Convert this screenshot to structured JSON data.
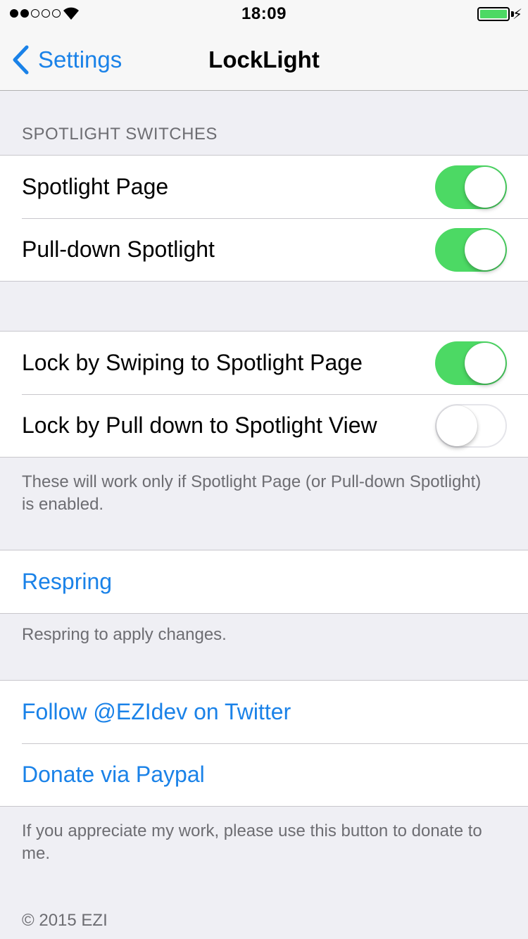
{
  "status_bar": {
    "time": "18:09",
    "signal_bars_filled": 2,
    "signal_bars_total": 5,
    "battery_level": 1.0,
    "charging": true,
    "icons": [
      "wifi-icon",
      "battery-icon",
      "charging-bolt-icon"
    ]
  },
  "nav": {
    "back_label": "Settings",
    "title": "LockLight"
  },
  "sections": {
    "spotlight_header": "SPOTLIGHT SWITCHES",
    "switches": [
      {
        "label": "Spotlight Page",
        "on": true
      },
      {
        "label": "Pull-down Spotlight",
        "on": true
      }
    ],
    "lock": [
      {
        "label": "Lock by Swiping to Spotlight Page",
        "on": true
      },
      {
        "label": "Lock by Pull down to Spotlight View",
        "on": false
      }
    ],
    "lock_footer": "These will work only if Spotlight Page (or Pull-down Spotlight) is enabled.",
    "respring_label": "Respring",
    "respring_footer": "Respring to apply changes.",
    "twitter_label": "Follow @EZIdev on Twitter",
    "paypal_label": "Donate via Paypal",
    "donate_footer": "If you appreciate my work, please use this button to donate to me.",
    "copyright": "© 2015  EZI"
  },
  "colors": {
    "accent": "#1a82e8",
    "switch_on": "#4cd964",
    "background": "#efeff4",
    "secondary_text": "#6d6d72"
  }
}
